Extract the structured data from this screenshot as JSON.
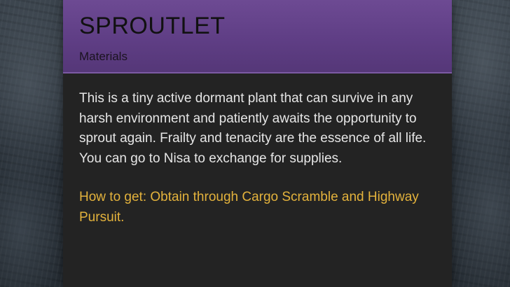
{
  "item": {
    "name": "SPROUTLET",
    "category": "Materials",
    "description": "This is a tiny active dormant plant that can survive in any harsh environment and patiently awaits the opportunity to sprout again. Frailty and tenacity are the essence of all life. You can go to Nisa to exchange for supplies.",
    "how_to_get": "How to get: Obtain through Cargo Scramble and Highway Pursuit."
  },
  "colors": {
    "header_purple": "#5f3e85",
    "panel_bg": "#232323",
    "body_text": "#e6e6e6",
    "acquire_text": "#e3b23c"
  }
}
